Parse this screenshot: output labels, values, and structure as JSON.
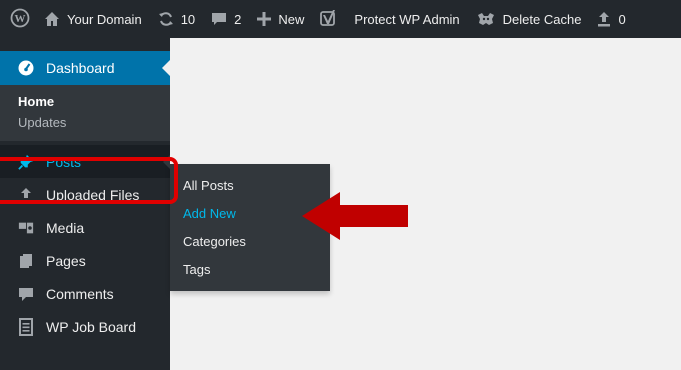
{
  "adminbar": {
    "site_name": "Your Domain",
    "updates_count": "10",
    "comments_count": "2",
    "new_label": "New",
    "protect_label": "Protect WP Admin",
    "cache_label": "Delete Cache",
    "uploads_count": "0"
  },
  "sidebar": {
    "dashboard": "Dashboard",
    "home": "Home",
    "updates": "Updates",
    "posts": "Posts",
    "uploaded_files": "Uploaded Files",
    "media": "Media",
    "pages": "Pages",
    "comments": "Comments",
    "wp_job_board": "WP Job Board"
  },
  "flyout": {
    "items": [
      "All Posts",
      "Add New",
      "Categories",
      "Tags"
    ],
    "active": "Add New"
  },
  "colors": {
    "adminbar_bg": "#23282d",
    "accent": "#0073aa",
    "active_link": "#00b9eb",
    "annotation": "#e00000",
    "arrow": "#c00000"
  },
  "icons": [
    "wordpress-icon",
    "home-icon",
    "updates-icon",
    "comment-icon",
    "plus-icon",
    "yoast-icon",
    "cache-icon",
    "upload-icon",
    "dashboard-icon",
    "pin-icon",
    "media-icon",
    "pages-icon",
    "comments-icon",
    "document-icon"
  ]
}
